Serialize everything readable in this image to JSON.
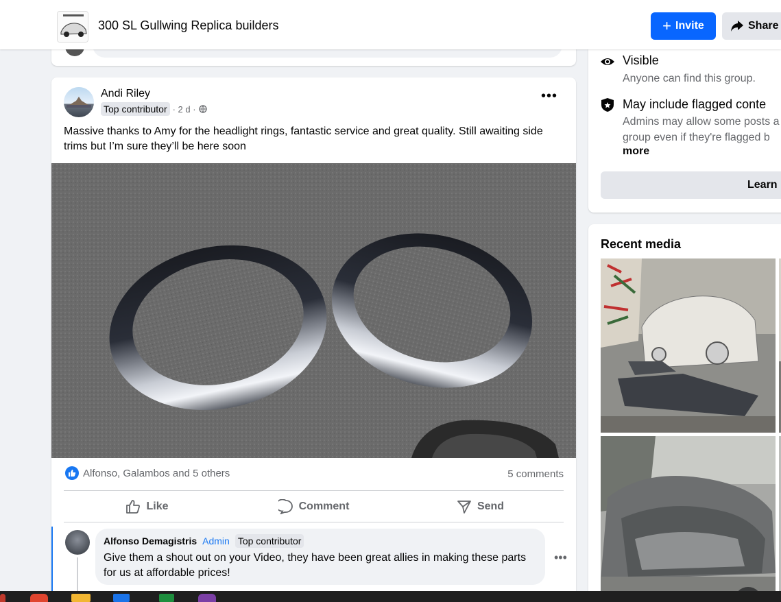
{
  "header": {
    "group_name": "300 SL Gullwing Replica builders",
    "invite_label": "Invite",
    "share_label": "Share"
  },
  "post": {
    "author": "Andi Riley",
    "badge": "Top contributor",
    "time": "· 2 d ·",
    "text": "Massive thanks to Amy for the headlight rings, fantastic service and great quality. Still awaiting side trims but I’m sure they’ll be here soon",
    "reactions": "Alfonso, Galambos and 5 others",
    "comments_count": "5 comments",
    "actions": {
      "like": "Like",
      "comment": "Comment",
      "send": "Send"
    }
  },
  "comment": {
    "author": "Alfonso Demagistris",
    "admin": "Admin",
    "badge": "Top contributor",
    "text": "Give them a shout out on your Video, they have been great allies in making these parts for us at affordable prices!"
  },
  "about": {
    "visible_title": "Visible",
    "visible_sub": "Anyone can find this group.",
    "flagged_title": "May include flagged conte",
    "flagged_sub_1": "Admins may allow some posts a",
    "flagged_sub_2": "group even if they're flagged b",
    "more": "more",
    "learn": "Learn"
  },
  "media": {
    "title": "Recent media"
  },
  "colors": {
    "primary": "#0866ff",
    "link": "#1877f2",
    "secondary_text": "#65676b",
    "background": "#f0f2f5"
  }
}
